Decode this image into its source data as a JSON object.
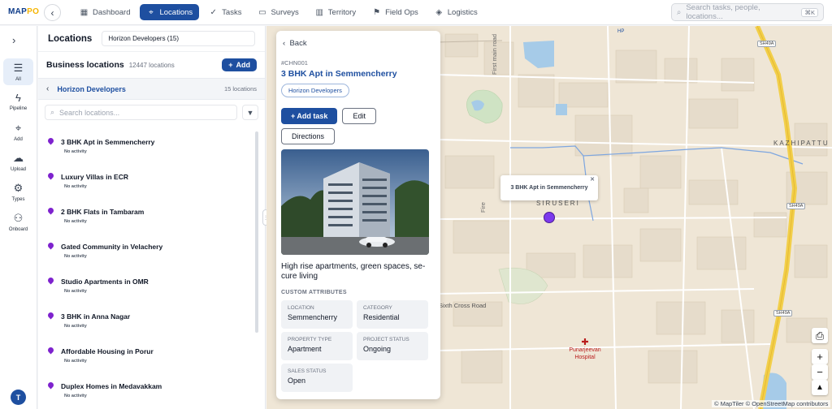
{
  "app": {
    "logo_main": "MAP",
    "logo_accent": "PO"
  },
  "nav": [
    {
      "label": "Dashboard",
      "icon": "dashboard-icon",
      "glyph": "▦"
    },
    {
      "label": "Locations",
      "icon": "location-icon",
      "glyph": "⌖"
    },
    {
      "label": "Tasks",
      "icon": "tasks-icon",
      "glyph": "✓"
    },
    {
      "label": "Surveys",
      "icon": "clipboard-icon",
      "glyph": "▭"
    },
    {
      "label": "Territory",
      "icon": "map-icon",
      "glyph": "▥"
    },
    {
      "label": "Field Ops",
      "icon": "flag-icon",
      "glyph": "⚑"
    },
    {
      "label": "Logistics",
      "icon": "box-icon",
      "glyph": "◈"
    }
  ],
  "search": {
    "placeholder": "Search tasks, people, locations...",
    "shortcut": "⌘K"
  },
  "rail": [
    {
      "label": "All",
      "icon": "list-icon",
      "glyph": "☰"
    },
    {
      "label": "Pipeline",
      "icon": "bolt-icon",
      "glyph": "ϟ"
    },
    {
      "label": "Add",
      "icon": "pin-icon",
      "glyph": "⌖"
    },
    {
      "label": "Upload",
      "icon": "cloud-upload-icon",
      "glyph": "☁"
    },
    {
      "label": "Types",
      "icon": "gear-icon",
      "glyph": "⚙"
    },
    {
      "label": "Onboard",
      "icon": "user-icon",
      "glyph": "⚇"
    }
  ],
  "user": {
    "initial": "T"
  },
  "panel": {
    "title": "Locations",
    "filter_value": "Horizon Developers (15)",
    "business_title": "Business locations",
    "business_count": "12447 locations",
    "add_label": "Add",
    "group_name": "Horizon Developers",
    "group_count": "15 locations",
    "search_placeholder": "Search locations..."
  },
  "locations": [
    {
      "name": "3 BHK Apt in Semmencherry",
      "status": "No activity"
    },
    {
      "name": "Luxury Villas in ECR",
      "status": "No activity"
    },
    {
      "name": "2 BHK Flats in Tambaram",
      "status": "No activity"
    },
    {
      "name": "Gated Community in Velachery",
      "status": "No activity"
    },
    {
      "name": "Studio Apartments in OMR",
      "status": "No activity"
    },
    {
      "name": "3 BHK in Anna Nagar",
      "status": "No activity"
    },
    {
      "name": "Affordable Housing in Porur",
      "status": "No activity"
    },
    {
      "name": "Duplex Homes in Medavakkam",
      "status": "No activity"
    }
  ],
  "detail": {
    "back_label": "Back",
    "id": "#CHN001",
    "title": "3 BHK Apt in Semmencherry",
    "tag": "Horizon Developers",
    "add_task_label": "+ Add task",
    "edit_label": "Edit",
    "directions_label": "Directions",
    "description": "High rise apartments, green spaces, se-cure living",
    "section_label": "CUSTOM ATTRIBUTES",
    "attributes": [
      {
        "label": "LOCATION",
        "value": "Semmencherry"
      },
      {
        "label": "CATEGORY",
        "value": "Residential"
      },
      {
        "label": "PROPERTY TYPE",
        "value": "Apartment"
      },
      {
        "label": "PROJECT STATUS",
        "value": "Ongoing"
      },
      {
        "label": "SALES STATUS",
        "value": "Open"
      }
    ]
  },
  "map": {
    "popup_text": "3 BHK Apt in Semmencherry",
    "labels": {
      "siruseri": "SIRUSERI",
      "kazhipattur": "KAZHIPATTU",
      "first_main_road": "First main road",
      "sixth_cross_road": "Sixth Cross Road",
      "hospital": "Punarjeevan Hospital",
      "hp": "HP",
      "shield_1": "SH49A",
      "shield_2": "SH49A",
      "shield_3": "SH49A",
      "fire": "Fire"
    },
    "attribution": "© MapTiler © OpenStreetMap contributors"
  }
}
